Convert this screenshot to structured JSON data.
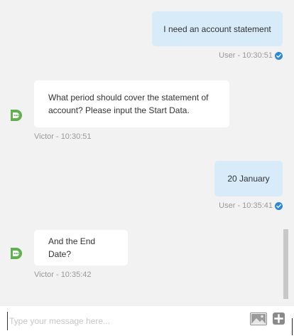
{
  "messages": [
    {
      "sender": "user",
      "text": "I need an account statement",
      "meta": "User - 10:30:51",
      "read": true
    },
    {
      "sender": "bot",
      "text": "What period should cover the statement of account? Please input the Start Data.",
      "meta": "Victor - 10:30:51"
    },
    {
      "sender": "user",
      "text": "20 January",
      "meta": "User - 10:35:41",
      "read": true
    },
    {
      "sender": "bot",
      "text": "And the End Date?",
      "meta": "Victor - 10:35:42"
    }
  ],
  "composer": {
    "placeholder": "Type your message here..."
  },
  "icons": {
    "avatar": "bot-logo-icon",
    "read": "checkmark-icon",
    "attach_image": "image-icon",
    "add": "plus-icon"
  },
  "colors": {
    "user_bubble": "#d8ebf9",
    "bot_bubble": "#ffffff",
    "background": "#f2f2f2",
    "avatar_green": "#5fb14b",
    "check_blue": "#2b87da"
  }
}
